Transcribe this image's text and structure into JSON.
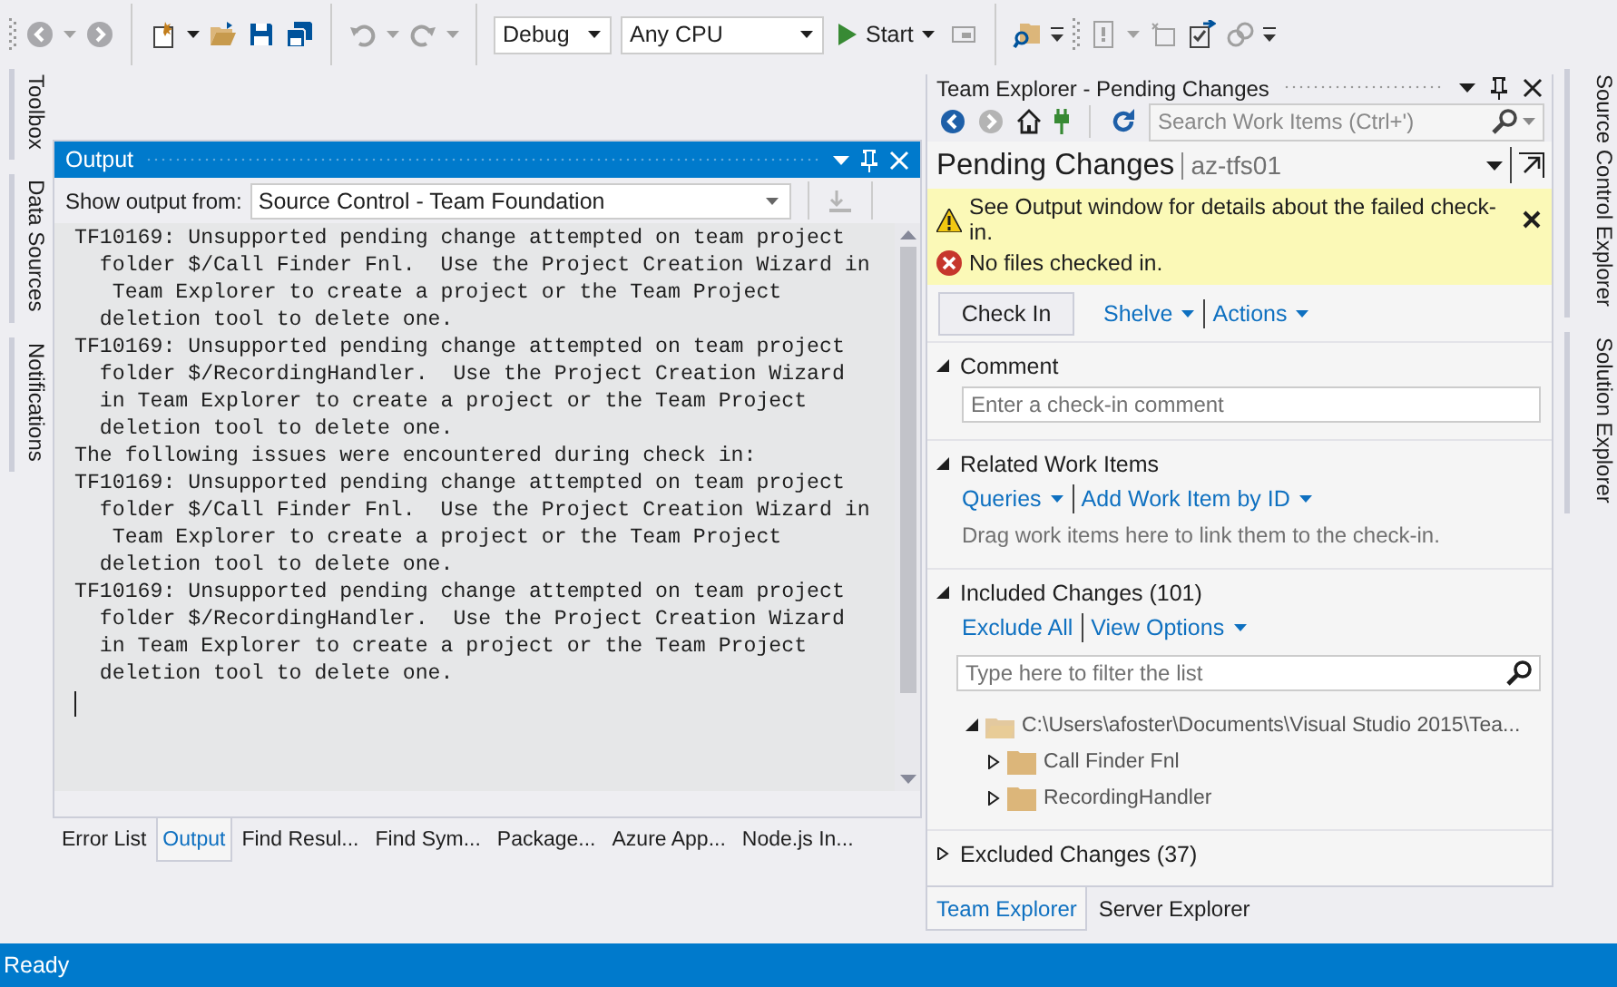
{
  "toolbar": {
    "configuration": "Debug",
    "platform": "Any CPU",
    "start": "Start"
  },
  "left_tabs": [
    "Toolbox",
    "Data Sources",
    "Notifications"
  ],
  "output": {
    "title": "Output",
    "source_label": "Show output from:",
    "source": "Source Control - Team Foundation",
    "lines": [
      "TF10169: Unsupported pending change attempted on team project",
      "  folder $/Call Finder Fnl.  Use the Project Creation Wizard in",
      "   Team Explorer to create a project or the Team Project",
      "  deletion tool to delete one.",
      "TF10169: Unsupported pending change attempted on team project",
      "  folder $/RecordingHandler.  Use the Project Creation Wizard",
      "  in Team Explorer to create a project or the Team Project",
      "  deletion tool to delete one.",
      "The following issues were encountered during check in:",
      "TF10169: Unsupported pending change attempted on team project",
      "  folder $/Call Finder Fnl.  Use the Project Creation Wizard in",
      "   Team Explorer to create a project or the Team Project",
      "  deletion tool to delete one.",
      "TF10169: Unsupported pending change attempted on team project",
      "  folder $/RecordingHandler.  Use the Project Creation Wizard",
      "  in Team Explorer to create a project or the Team Project",
      "  deletion tool to delete one."
    ]
  },
  "bottom_tabs": [
    {
      "label": "Error List",
      "selected": false
    },
    {
      "label": "Output",
      "selected": true
    },
    {
      "label": "Find Resul...",
      "selected": false
    },
    {
      "label": "Find Sym...",
      "selected": false
    },
    {
      "label": "Package...",
      "selected": false
    },
    {
      "label": "Azure App...",
      "selected": false
    },
    {
      "label": "Node.js In...",
      "selected": false
    }
  ],
  "team_explorer": {
    "title": "Team Explorer - Pending Changes",
    "search": {
      "placeholder": "Search Work Items (Ctrl+')"
    },
    "page": "Pending Changes",
    "server": "az-tfs01",
    "messages": [
      {
        "kind": "warning",
        "text": "See Output window for details about the failed check-in."
      },
      {
        "kind": "error",
        "text": "No files checked in."
      }
    ],
    "check_in": "Check In",
    "menus": [
      {
        "label": "Shelve",
        "dropdown": true
      },
      {
        "label": "Actions",
        "dropdown": true
      }
    ],
    "sections": [
      {
        "kind": "comment",
        "title": "Comment",
        "expanded": true,
        "placeholder": "Enter a check-in comment"
      },
      {
        "kind": "work_items",
        "title": "Related Work Items",
        "expanded": true,
        "links": [
          {
            "label": "Queries",
            "dropdown": true
          },
          {
            "label": "Add Work Item by ID",
            "dropdown": true
          }
        ],
        "hint": "Drag work items here to link them to the check-in."
      },
      {
        "kind": "changes",
        "title": "Included Changes (101)",
        "expanded": true,
        "links": [
          {
            "label": "Exclude All",
            "dropdown": false
          },
          {
            "label": "View Options",
            "dropdown": true
          }
        ],
        "filter": {
          "placeholder": "Type here to filter the list"
        },
        "tree": [
          {
            "label": "C:\\Users\\afoster\\Documents\\Visual Studio 2015\\Tea...",
            "expanded": true,
            "children": [
              {
                "label": "Call Finder Fnl",
                "expanded": false
              },
              {
                "label": "RecordingHandler",
                "expanded": false
              }
            ]
          }
        ]
      },
      {
        "kind": "changes",
        "title": "Excluded Changes (37)",
        "expanded": false
      }
    ]
  },
  "team_tabs": [
    {
      "label": "Team Explorer",
      "selected": true
    },
    {
      "label": "Server Explorer",
      "selected": false
    }
  ],
  "right_tabs": [
    "Source Control Explorer",
    "Solution Explorer"
  ],
  "status_bar": "Ready"
}
